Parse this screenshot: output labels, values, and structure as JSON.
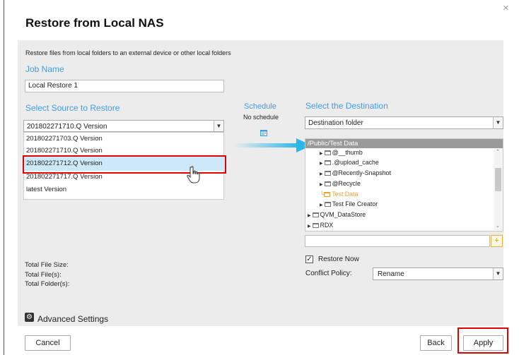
{
  "dialog": {
    "title": "Restore from Local NAS",
    "close_label": "×",
    "description": "Restore files from local folders to an external device or other local folders"
  },
  "job": {
    "label": "Job Name",
    "value": "Local Restore 1"
  },
  "source": {
    "label": "Select Source to Restore",
    "selected": "201802271710.Q  Version",
    "options": [
      "201802271703.Q Version",
      "201802271710.Q Version",
      "201802271712.Q Version",
      "201802271717.Q Version",
      "latest Version"
    ],
    "hovered_index": 2
  },
  "schedule": {
    "label": "Schedule",
    "value": "No schedule"
  },
  "destination": {
    "label": "Select the Destination",
    "type_selected": "Destination folder",
    "tree_root": "/Public/Test Data",
    "tree_items": [
      "@__thumb",
      ".@upload_cache",
      "@Recently-Snapshot",
      "@Recycle",
      "Test Data",
      "Test File Creator",
      "QVM_DataStore",
      "RDX"
    ],
    "selected_item": "Test Data",
    "path_value": ""
  },
  "totals": {
    "file_size_label": "Total File Size:",
    "files_label": "Total File(s):",
    "folders_label": "Total Folder(s):"
  },
  "options": {
    "restore_now_label": "Restore Now",
    "restore_now_checked": true,
    "conflict_label": "Conflict Policy:",
    "conflict_value": "Rename"
  },
  "advanced_label": "Advanced Settings",
  "buttons": {
    "cancel": "Cancel",
    "back": "Back",
    "apply": "Apply"
  },
  "colors": {
    "accent": "#3f9de0",
    "highlight": "#e00000",
    "arrow": "#29b6e8"
  },
  "icons": {
    "calendar": "calendar-icon",
    "add_folder": "add-folder-icon",
    "settings": "gear-icon",
    "pointer": "hand-pointer-icon"
  }
}
